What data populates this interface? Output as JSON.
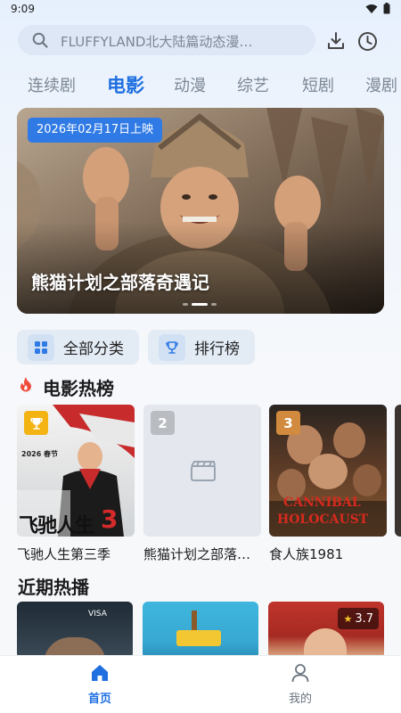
{
  "status_bar": {
    "time": "9:09"
  },
  "search": {
    "placeholder": "FLUFFYLAND北大陆篇动态漫…"
  },
  "tabs": [
    "连续剧",
    "电影",
    "动漫",
    "综艺",
    "短剧",
    "漫剧"
  ],
  "active_tab": "电影",
  "banner": {
    "date_badge": "2026年02月17日上映",
    "title": "熊猫计划之部落奇遇记"
  },
  "quick_links": {
    "all_categories": "全部分类",
    "ranking": "排行榜"
  },
  "hot_section": {
    "title": "电影热榜",
    "items": [
      {
        "rank": "",
        "title": "飞驰人生第三季"
      },
      {
        "rank": "2",
        "title": "熊猫计划之部落…"
      },
      {
        "rank": "3",
        "title": "食人族1981"
      }
    ]
  },
  "poster_texts": {
    "p1_top": "2026 春节",
    "p1_big": "飞驰人生",
    "p1_num": "3",
    "p3_line1": "CANNIBAL",
    "p3_line2": "HOLOCAUST"
  },
  "recent_section": {
    "title": "近期热播",
    "cards": [
      {
        "caption": "VISA"
      },
      {
        "caption": ""
      },
      {
        "rating": "3.7"
      }
    ]
  },
  "bottom_nav": {
    "home": "首页",
    "mine": "我的"
  },
  "colors": {
    "accent": "#1e6fe0",
    "badge_blue": "#2f7ae5",
    "rank_gold": "#f3b312",
    "rank_silver": "#b9bdc2",
    "rank_bronze": "#d18a3e"
  }
}
